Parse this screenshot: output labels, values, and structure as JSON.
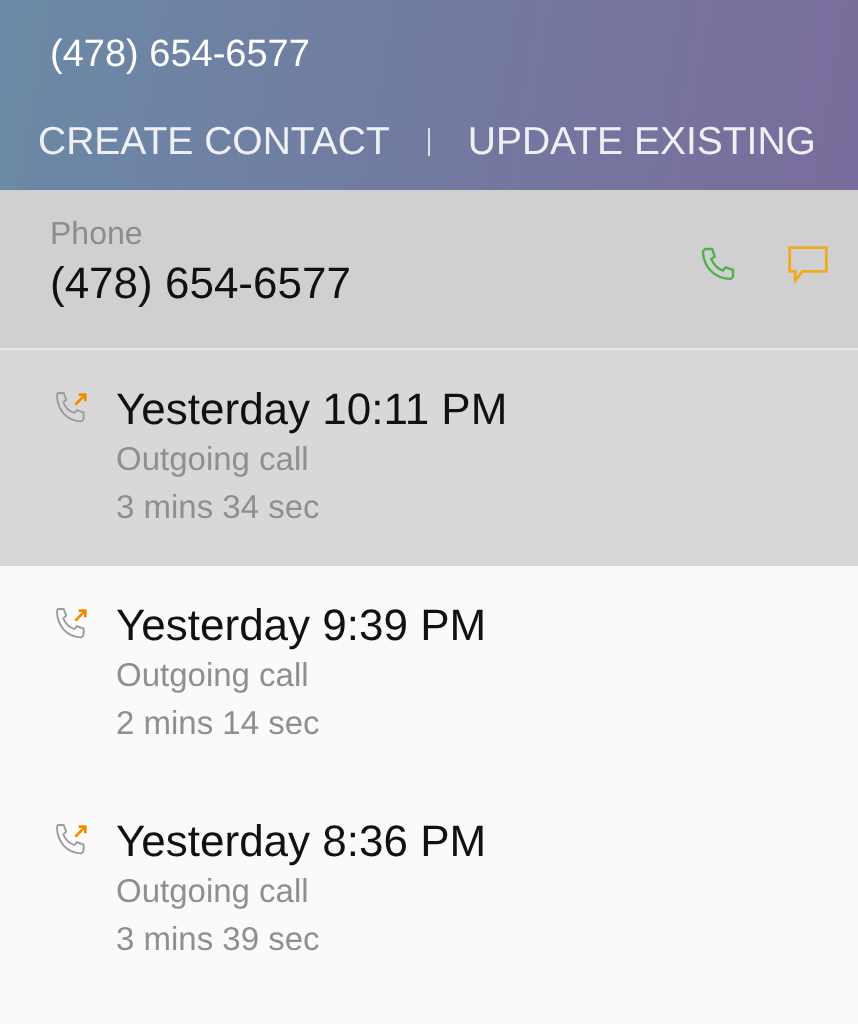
{
  "header": {
    "title": "(478) 654-6577",
    "actions": [
      "CREATE CONTACT",
      "UPDATE EXISTING"
    ]
  },
  "phone": {
    "label": "Phone",
    "number": "(478) 654-6577"
  },
  "calls": [
    {
      "time": "Yesterday 10:11 PM",
      "type": "Outgoing call",
      "duration": "3 mins 34 sec",
      "selected": true
    },
    {
      "time": "Yesterday 9:39 PM",
      "type": "Outgoing call",
      "duration": "2 mins 14 sec",
      "selected": false
    },
    {
      "time": "Yesterday 8:36 PM",
      "type": "Outgoing call",
      "duration": "3 mins 39 sec",
      "selected": false
    }
  ]
}
